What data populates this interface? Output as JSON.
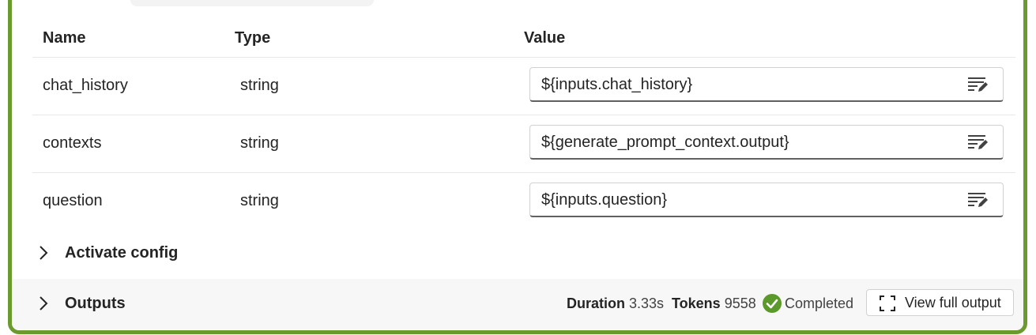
{
  "table": {
    "headers": {
      "name": "Name",
      "type": "Type",
      "value": "Value"
    },
    "rows": [
      {
        "name": "chat_history",
        "type": "string",
        "value": "${inputs.chat_history}"
      },
      {
        "name": "contexts",
        "type": "string",
        "value": "${generate_prompt_context.output}"
      },
      {
        "name": "question",
        "type": "string",
        "value": "${inputs.question}"
      }
    ],
    "row_icon": "edit-text-icon"
  },
  "sections": {
    "activate": {
      "title": "Activate config",
      "icon": "chevron-right-icon"
    },
    "outputs": {
      "title": "Outputs",
      "icon": "chevron-right-icon",
      "duration_label": "Duration",
      "duration_value": "3.33s",
      "tokens_label": "Tokens",
      "tokens_value": "9558",
      "status": "Completed",
      "status_icon": "check-circle-icon",
      "view_button": "View full output",
      "view_button_icon": "expand-icon"
    }
  },
  "colors": {
    "accent_border": "#6b9a2f",
    "status_success": "#5b9a2a"
  }
}
